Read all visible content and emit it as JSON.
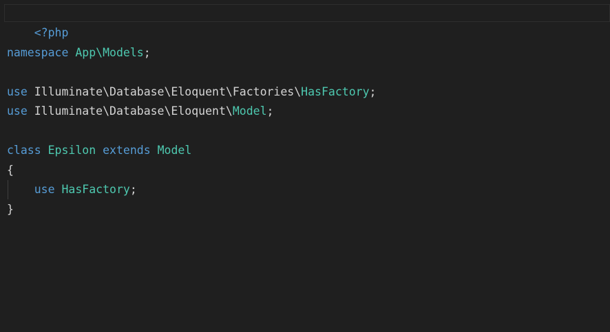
{
  "editor": {
    "breadcrumb": "· · · · · · · · · ·",
    "lines": {
      "l1": {
        "open_tag": "<?php"
      },
      "l3": {
        "kw": "namespace",
        "ns": "App\\Models",
        "semi": ";"
      },
      "l5": {
        "kw": "use",
        "path": "Illuminate\\Database\\Eloquent\\Factories\\",
        "type": "HasFactory",
        "semi": ";"
      },
      "l6": {
        "kw": "use",
        "path": "Illuminate\\Database\\Eloquent\\",
        "type": "Model",
        "semi": ";"
      },
      "l8": {
        "kw": "class",
        "name": "Epsilon",
        "kw2": "extends",
        "parent": "Model"
      },
      "l9": {
        "brace": "{"
      },
      "l10": {
        "kw": "use",
        "type": "HasFactory",
        "semi": ";"
      },
      "l11": {
        "brace": "}"
      }
    },
    "colors": {
      "background": "#1f1f1f",
      "keyword": "#569cd6",
      "type": "#4ec9b0",
      "plain": "#d4d4d4"
    }
  }
}
